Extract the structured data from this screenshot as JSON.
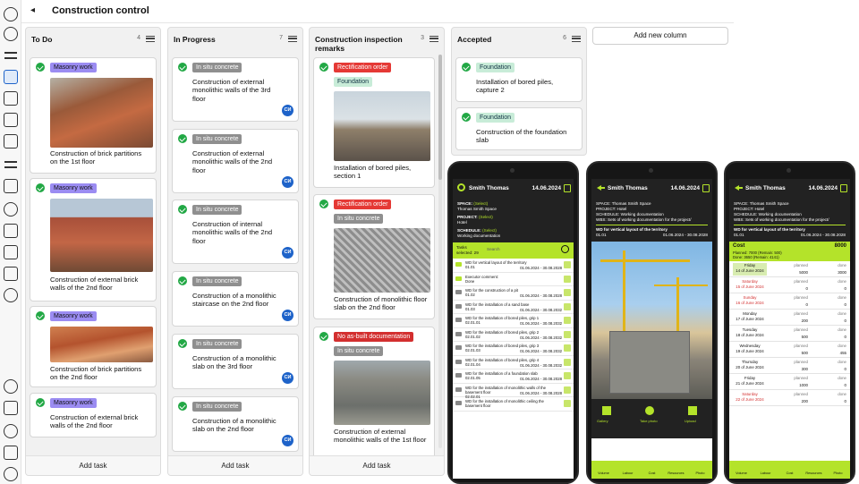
{
  "header": {
    "back": "◂",
    "title": "Construction control"
  },
  "rail_icons": [
    "home-icon",
    "globe-icon",
    "list-icon",
    "board-icon",
    "chart-icon",
    "layers-icon",
    "flag-icon",
    "lines-icon",
    "grid-icon",
    "database-icon",
    "text-icon",
    "table-icon",
    "calendar-icon",
    "eye-icon",
    "sun-icon",
    "message-icon",
    "bell-icon",
    "translate-icon",
    "info-icon"
  ],
  "add_column": "Add new column",
  "add_task": "Add task",
  "columns": [
    {
      "title": "To Do",
      "count": "4",
      "cards": [
        {
          "tag": "Masonry work",
          "text": "Construction of brick partitions on the 1st floor"
        },
        {
          "tag": "Masonry work",
          "text": "Construction of external brick walls of the 2nd floor"
        },
        {
          "tag": "Masonry work",
          "text": "Construction of brick partitions on the 2nd floor"
        },
        {
          "tag": "Masonry work",
          "text": "Construction of external brick walls of the 2nd floor"
        }
      ]
    },
    {
      "title": "In Progress",
      "count": "7",
      "cards": [
        {
          "tag": "In situ concrete",
          "text": "Construction of external monolithic walls of the 3rd floor",
          "badge": "СИ"
        },
        {
          "tag": "In situ concrete",
          "text": "Construction of external monolithic walls of the 2nd floor",
          "badge": "СИ"
        },
        {
          "tag": "In situ concrete",
          "text": "Construction of internal monolithic walls of the 2nd floor",
          "badge": "СИ"
        },
        {
          "tag": "In situ concrete",
          "text": "Construction of a monolithic staircase on the 2nd floor",
          "badge": "СИ"
        },
        {
          "tag": "In situ concrete",
          "text": "Construction of a monolithic slab on the 3rd floor",
          "badge": "СИ"
        },
        {
          "tag": "In situ concrete",
          "text": "Construction of a monolithic slab on the 2nd floor",
          "badge": "СИ"
        }
      ]
    },
    {
      "title": "Construction inspection remarks",
      "count": "3",
      "cards": [
        {
          "tag": "Rectification order",
          "tag2": "Foundation",
          "text": "Installation of bored piles, section 1"
        },
        {
          "tag": "Rectification order",
          "tag2": "In situ concrete",
          "text": "Construction of monolithic floor slab on the 2nd floor"
        },
        {
          "tag": "No as-built documentation",
          "tag2": "In situ concrete",
          "text": "Construction of external monolithic walls of the 1st floor"
        }
      ]
    },
    {
      "title": "Accepted",
      "count": "6",
      "cards": [
        {
          "tag": "Foundation",
          "text": "Installation of bored piles, capture 2"
        },
        {
          "tag": "Foundation",
          "text": "Construction of the foundation slab"
        }
      ]
    }
  ],
  "phone1": {
    "name": "Smith Thomas",
    "date": "14.06.2024",
    "space_label": "SPACE:",
    "space_sel": "(Select)",
    "space_val": "Thomas Smith Space",
    "project_label": "PROJECT:",
    "project_sel": "(Select)",
    "project_val": "Hotel",
    "schedule_label": "SCHEDULE:",
    "schedule_sel": "(Select)",
    "schedule_val": "Working documentation",
    "tasks_label": "Tasks",
    "selected": "selected: 29",
    "search": "Search",
    "tasks": [
      {
        "t": "WD for vertical layout of the territory",
        "c": "01.01",
        "d": "01.06.2024 - 30.08.2028",
        "g": true
      },
      {
        "t": "Executor comment:",
        "c": "Done",
        "d": "",
        "g": true
      },
      {
        "t": "WD for the construction of a pit",
        "c": "01.02",
        "d": "01.06.2024 - 30.08.2028",
        "g": false
      },
      {
        "t": "WD for the installation of a sand base",
        "c": "01.03",
        "d": "01.06.2024 - 30.08.2032",
        "g": false
      },
      {
        "t": "WD for the installation of bored piles, grip 1",
        "c": "02.01.01",
        "d": "01.06.2024 - 30.08.2032",
        "g": false
      },
      {
        "t": "WD for the installation of bored piles, grip 2",
        "c": "02.01.02",
        "d": "01.06.2024 - 30.08.2032",
        "g": false
      },
      {
        "t": "WD for the installation of bored piles, grip 3",
        "c": "02.01.03",
        "d": "01.06.2024 - 30.08.2032",
        "g": false
      },
      {
        "t": "WD for the installation of bored piles, grip 4",
        "c": "02.01.04",
        "d": "01.06.2024 - 30.08.2032",
        "g": false
      },
      {
        "t": "WD for the installation of a foundation slab",
        "c": "02.01.05",
        "d": "01.06.2024 - 30.08.2028",
        "g": false
      },
      {
        "t": "WD for the installation of monolithic walls of the basement floor",
        "c": "02.02.01",
        "d": "01.06.2024 - 30.08.2028",
        "g": false
      },
      {
        "t": "WD for the installation of monolithic ceiling the basement floor",
        "c": "",
        "d": "",
        "g": false
      }
    ]
  },
  "phone2": {
    "name": "Smith Thomas",
    "date": "14.06.2024",
    "space": "SPACE: Thomas Smith Space",
    "project": "PROJECT: Hotel",
    "schedule": "SCHEDULE: Working documentation",
    "wbs": "WBS: Sets of working documentation for the project/",
    "wd": "WD for vertical layout of the territory",
    "code": "01.01",
    "range": "01.06.2024 - 30.08.2028",
    "actions": [
      "Gallery",
      "Take photo",
      "Upload"
    ],
    "nav": [
      "Volume",
      "Labour",
      "Cost",
      "Resources",
      "Photo"
    ]
  },
  "phone3": {
    "name": "Smith Thomas",
    "date": "14.06.2024",
    "space": "SPACE: Thomas Smith Space",
    "project": "PROJECT: Hotel",
    "schedule": "SCHEDULE: Working documentation",
    "wbs": "WBS: Sets of working documentation for the project/",
    "wd": "WD for vertical layout of the territory",
    "code": "01.01",
    "range": "01.06.2024 - 30.08.2028",
    "cost_label": "Cost",
    "cost_val": "8000",
    "planned": "Planned: 7000 (Remain: 500)",
    "done": "Done: 3650 (Remain: 4141)",
    "col_planned": "planned",
    "col_done": "done",
    "rows": [
      {
        "dow": "Friday",
        "date": "14 of June 2024",
        "p": "5000",
        "d": "3000",
        "wk": false,
        "hi": true
      },
      {
        "dow": "Saturday",
        "date": "15 of June 2024",
        "p": "0",
        "d": "0",
        "wk": true,
        "hi": false
      },
      {
        "dow": "Sunday",
        "date": "16 of June 2024",
        "p": "0",
        "d": "0",
        "wk": true,
        "hi": false
      },
      {
        "dow": "Monday",
        "date": "17 of June 2024",
        "p": "200",
        "d": "0",
        "wk": false,
        "hi": false
      },
      {
        "dow": "Tuesday",
        "date": "18 of June 2024",
        "p": "500",
        "d": "0",
        "wk": false,
        "hi": false
      },
      {
        "dow": "Wednesday",
        "date": "19 of June 2024",
        "p": "500",
        "d": "455",
        "wk": false,
        "hi": false
      },
      {
        "dow": "Thursday",
        "date": "20 of June 2024",
        "p": "300",
        "d": "0",
        "wk": false,
        "hi": false
      },
      {
        "dow": "Friday",
        "date": "21 of June 2024",
        "p": "1000",
        "d": "0",
        "wk": false,
        "hi": false
      },
      {
        "dow": "Saturday",
        "date": "22 of June 2024",
        "p": "200",
        "d": "0",
        "wk": true,
        "hi": false
      }
    ],
    "nav": [
      "Volume",
      "Labour",
      "Cost",
      "Resources",
      "Photo"
    ]
  }
}
